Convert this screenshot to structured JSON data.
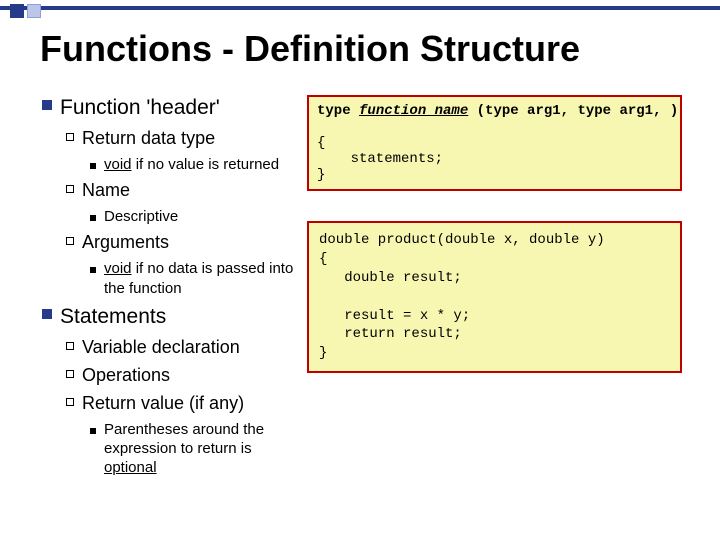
{
  "title": "Functions - Definition Structure",
  "left": {
    "heading1": "Function 'header'",
    "returnType": "Return data type",
    "voidReturn_a": "void",
    "voidReturn_b": " if no value is returned",
    "name": "Name",
    "descriptive": "Descriptive",
    "arguments": "Arguments",
    "voidArg_a": "void",
    "voidArg_b": " if no data is passed into the function",
    "heading2": "Statements",
    "vardecl": "Variable declaration",
    "ops": "Operations",
    "retval": "Return value (if any)",
    "parens_a": "Parentheses around the expression to return is ",
    "parens_b": "optional"
  },
  "box1": {
    "line1_pre": "type ",
    "line1_fn": "function_name",
    "line1_post": " (type arg1, type arg1, )",
    "open": "{",
    "stmts": "    statements;",
    "close": "}"
  },
  "box2": {
    "sig": "double product(double x, double y)",
    "open": "{",
    "decl": "   double result;",
    "blank": " ",
    "calc": "   result = x * y;",
    "ret": "   return result;",
    "close": "}"
  }
}
